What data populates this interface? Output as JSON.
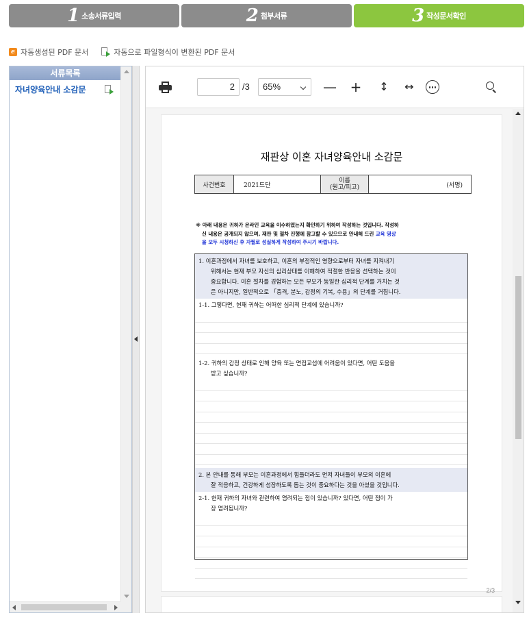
{
  "steps": [
    {
      "num": "1",
      "label": "소송서류입력",
      "active": false
    },
    {
      "num": "2",
      "label": "첨부서류",
      "active": false
    },
    {
      "num": "3",
      "label": "작성문서확인",
      "active": true
    }
  ],
  "legend": {
    "auto_pdf": "자동생성된 PDF 문서",
    "converted_pdf": "자동으로 파일형식이 변환된 PDF 문서"
  },
  "sidebar": {
    "header": "서류목록",
    "items": [
      {
        "label": "자녀양육안내 소감문"
      }
    ]
  },
  "viewer": {
    "page_current": "2",
    "page_total": "/3",
    "zoom": "65%",
    "zoom_out": "—",
    "zoom_in": "+",
    "fit_height": "↕",
    "fit_width": "↔",
    "page_counter": "2/3"
  },
  "document": {
    "title": "재판상 이혼 자녀양육안내 소감문",
    "case_label": "사건번호",
    "case_number": "2021드단",
    "name_label": "이름",
    "name_sub": "(원고/피고)",
    "signature": "(서명)",
    "notice_line1": "※ 아래 내용은 귀하가 온라인 교육을 이수하였는지 확인하기 위하여 작성하는 것입니다. 작성하",
    "notice_line2": "신 내용은 공개되지 않으며, 재판 및 절차 진행에 참고할 수 있으므로 안내해 드린 ",
    "notice_blue1": "교육 영상",
    "notice_blue2": "을 모두 시청하신 후 자필로 성실하게 작성하여 주시기 바랍니다.",
    "q1_line1": "1. 이혼과정에서 자녀를 보호하고, 이혼의 부정적인 영향으로부터 자녀를 지켜내기",
    "q1_line2": "위해서는 현재 부모 자신의 심리상태를 이해하여 적절한 반응을 선택하는 것이",
    "q1_line3": "중요합니다. 이혼 절차를 경험하는 모든 부모가 동일한 심리적 단계를 거치는 것",
    "q1_line4": "은 아니지만, 일반적으로 「충격, 분노, 감정의 기복, 수용」의 단계를 거칩니다.",
    "q1_1": "1-1. 그렇다면, 현재 귀하는 어떠한 심리적 단계에 있습니까?",
    "q1_2_line1": "1-2. 귀하의 감정 상태로 인해 양육 또는 면접교섭에 어려움이 있다면, 어떤 도움을",
    "q1_2_line2": "받고 싶습니까?",
    "q2_line1": "2. 본 안내를 통해 부모는 이혼과정에서 힘들더라도 먼저 자녀들이 부모의 이혼에",
    "q2_line2": "잘 적응하고, 건강하게 성장하도록 돕는 것이 중요하다는 것을 아셨을 것입니다.",
    "q2_1_line1": "2-1. 현재 귀하의 자녀와 관련하여 염려되는 점이 있습니까? 있다면, 어떤 점이 가",
    "q2_1_line2": "장 염려됩니까?"
  },
  "colors": {
    "step_inactive": "#8c8c8c",
    "step_active": "#8cc63f",
    "list_link": "#1f5fb8",
    "notice_blue": "#1a2fd6"
  }
}
